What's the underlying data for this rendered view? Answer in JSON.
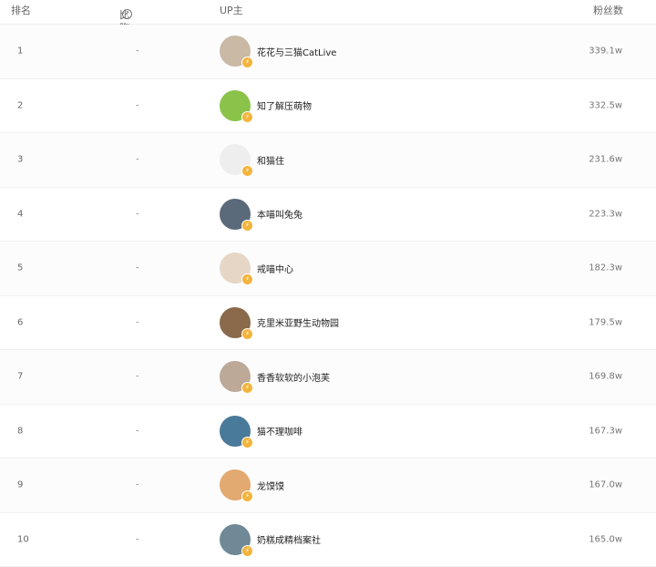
{
  "header": {
    "rank": "排名",
    "change": "比昨日",
    "change_help_icon": "question-circle-icon",
    "up": "UP主",
    "fans": "粉丝数"
  },
  "rows": [
    {
      "rank": "1",
      "change": "-",
      "name": "花花与三猫CatLive",
      "fans": "339.1w",
      "avatar_color": "#c9b9a5"
    },
    {
      "rank": "2",
      "change": "-",
      "name": "知了解压萌物",
      "fans": "332.5w",
      "avatar_color": "#8bc34a"
    },
    {
      "rank": "3",
      "change": "-",
      "name": "和猫住",
      "fans": "231.6w",
      "avatar_color": "#eeeeee"
    },
    {
      "rank": "4",
      "change": "-",
      "name": "本喵叫兔兔",
      "fans": "223.3w",
      "avatar_color": "#5a6a7a"
    },
    {
      "rank": "5",
      "change": "-",
      "name": "戒喵中心",
      "fans": "182.3w",
      "avatar_color": "#e6d6c6"
    },
    {
      "rank": "6",
      "change": "-",
      "name": "克里米亚野生动物园",
      "fans": "179.5w",
      "avatar_color": "#8a6a4a"
    },
    {
      "rank": "7",
      "change": "-",
      "name": "香香软软的小泡芙",
      "fans": "169.8w",
      "avatar_color": "#bca998"
    },
    {
      "rank": "8",
      "change": "-",
      "name": "猫不理咖啡",
      "fans": "167.3w",
      "avatar_color": "#4a7a9a"
    },
    {
      "rank": "9",
      "change": "-",
      "name": "龙馍馍",
      "fans": "167.0w",
      "avatar_color": "#e2a970"
    },
    {
      "rank": "10",
      "change": "-",
      "name": "奶糕成精档案社",
      "fans": "165.0w",
      "avatar_color": "#6f8a96"
    }
  ]
}
